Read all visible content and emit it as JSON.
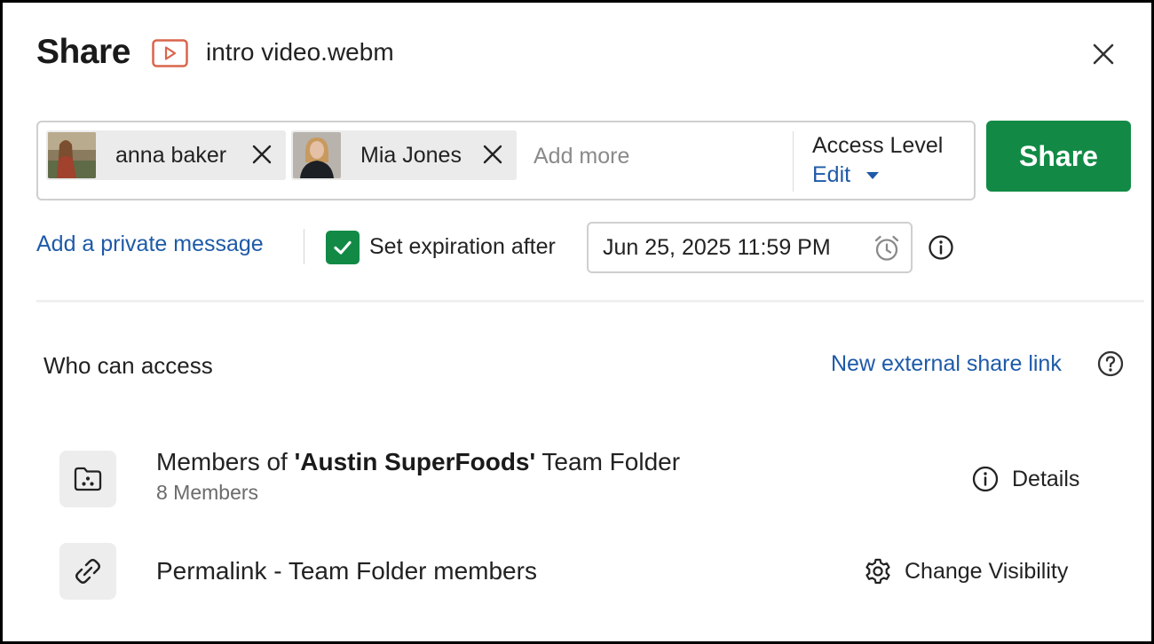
{
  "header": {
    "title": "Share",
    "file_icon": "video-file-icon",
    "file_name": "intro video.webm",
    "close_icon": "close-icon"
  },
  "recipients": {
    "chips": [
      {
        "name": "anna baker",
        "avatar": "avatar-photo"
      },
      {
        "name": "Mia Jones",
        "avatar": "avatar-photo"
      }
    ],
    "add_more_placeholder": "Add more",
    "access_level_label": "Access Level",
    "access_level_value": "Edit"
  },
  "share_button": "Share",
  "options": {
    "private_message": "Add a private message",
    "expiration_checked": true,
    "expiration_label": "Set expiration after",
    "expiration_value": "Jun 25, 2025 11:59 PM"
  },
  "who_can_access": {
    "title": "Who can access",
    "new_link": "New external share link",
    "rows": [
      {
        "icon": "team-folder-icon",
        "title_prefix": "Members of ",
        "title_bold": "'Austin SuperFoods'",
        "title_suffix": " Team Folder",
        "subtitle": "8 Members",
        "action": "Details",
        "action_icon": "info-icon"
      },
      {
        "icon": "link-icon",
        "title": "Permalink - Team Folder members",
        "action": "Change Visibility",
        "action_icon": "gear-icon"
      }
    ]
  },
  "colors": {
    "accent_green": "#128a46",
    "link_blue": "#1e5aa8",
    "video_icon": "#d9654b"
  }
}
